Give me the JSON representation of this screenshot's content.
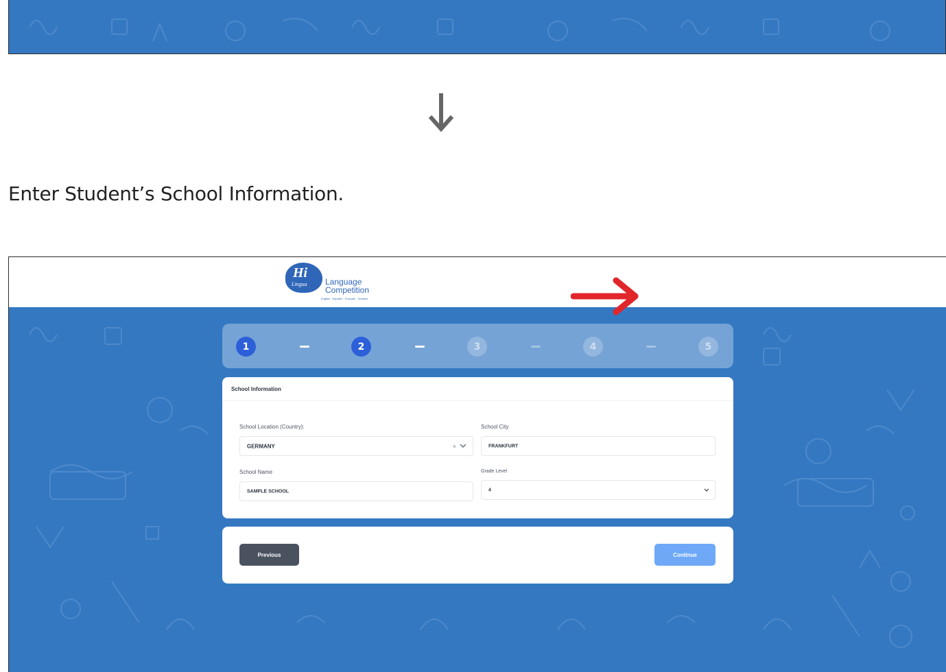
{
  "instruction": "Enter Student’s School Information.",
  "logo": {
    "hi": "Hi",
    "lingua": "Lingua",
    "line1": "Language",
    "line2": "Competition",
    "subline": "English · Español · Français · Deutsch"
  },
  "stepper": {
    "current_step": 2,
    "steps": [
      "1",
      "2",
      "3",
      "4",
      "5"
    ]
  },
  "form": {
    "title": "School Information",
    "country_label": "School Location (Country):",
    "country_value": "GERMANY",
    "country_clear": "×",
    "city_label": "School City",
    "city_value": "FRANKFURT",
    "name_label": "School Name",
    "name_value": "SAMPLE SCHOOL",
    "grade_label": "Grade Level",
    "grade_value": "4"
  },
  "nav": {
    "previous_label": "Previous",
    "continue_label": "Continue"
  },
  "colors": {
    "background_blue": "#3478c2",
    "active_step": "#2d5fd9",
    "continue_button": "#6ea8f7",
    "previous_button": "#4a5260",
    "callout_arrow": "#e1262b"
  },
  "icons": [
    "down-arrow-icon",
    "chevron-down-icon",
    "clear-icon",
    "red-arrow-icon"
  ]
}
